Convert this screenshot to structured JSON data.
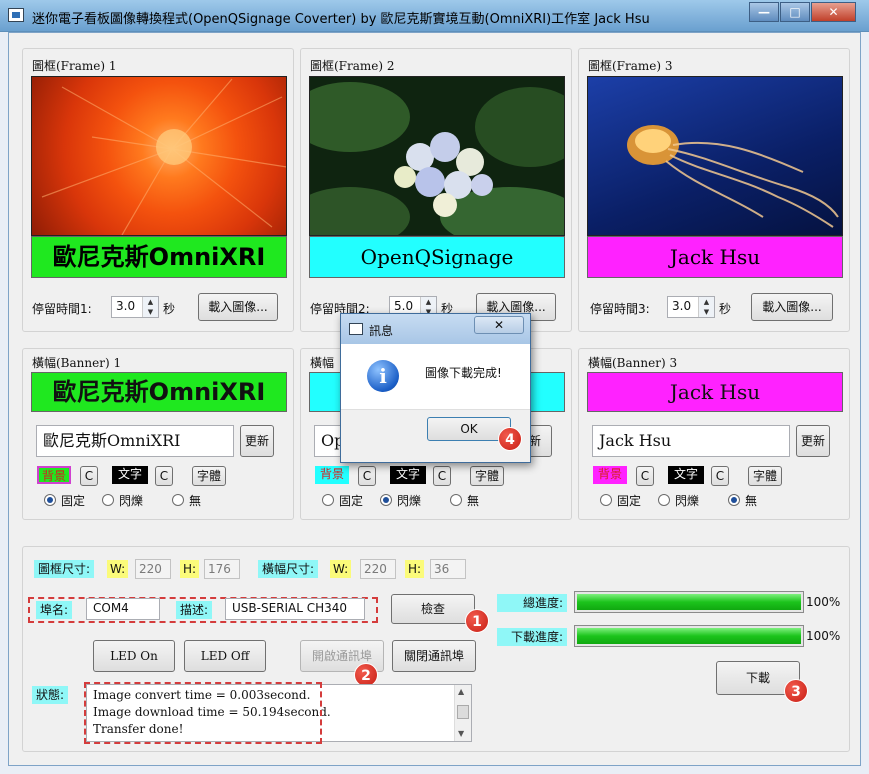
{
  "window": {
    "title": "迷你電子看板圖像轉換程式(OpenQSignage Coverter) by 歐尼克斯實境互動(OmniXRI)工作室 Jack Hsu",
    "minimize": "—",
    "maximize": "□",
    "close": "✕"
  },
  "frames": [
    {
      "label": "圖框(Frame) 1",
      "caption": "歐尼克斯OmniXRI",
      "caption_bg": "#1fe81f",
      "stay_label": "停留時間1:",
      "stay_value": "3.0",
      "unit": "秒",
      "load_button": "載入圖像..."
    },
    {
      "label": "圖框(Frame) 2",
      "caption": "OpenQSignage",
      "caption_bg": "#22ffff",
      "stay_label": "停留時間2:",
      "stay_value": "5.0",
      "unit": "秒",
      "load_button": "載入圖像..."
    },
    {
      "label": "圖框(Frame) 3",
      "caption": "Jack Hsu",
      "caption_bg": "#ff22ff",
      "stay_label": "停留時間3:",
      "stay_value": "3.0",
      "unit": "秒",
      "load_button": "載入圖像..."
    }
  ],
  "banners": [
    {
      "label": "橫幅(Banner) 1",
      "preview": "歐尼克斯OmniXRI",
      "text": "歐尼克斯OmniXRI",
      "bg": "#1fe81f",
      "update": "更新",
      "bg_label": "背景",
      "c": "C",
      "text_label": "文字",
      "font": "字體",
      "mode_fixed": "固定",
      "mode_blink": "閃爍",
      "mode_none": "無",
      "selected": "fixed"
    },
    {
      "label": "橫幅",
      "preview": "",
      "text": "Op",
      "bg": "#22ffff",
      "update": "新",
      "bg_label": "背景",
      "c": "C",
      "text_label": "文字",
      "font": "字體",
      "mode_fixed": "固定",
      "mode_blink": "閃爍",
      "mode_none": "無",
      "selected": "blink"
    },
    {
      "label": "橫幅(Banner) 3",
      "preview": "Jack Hsu",
      "text": "Jack Hsu",
      "bg": "#ff22ff",
      "update": "更新",
      "bg_label": "背景",
      "c": "C",
      "text_label": "文字",
      "font": "字體",
      "mode_fixed": "固定",
      "mode_blink": "閃爍",
      "mode_none": "無",
      "selected": "none"
    }
  ],
  "sizes": {
    "frame_size_label": "圖框尺寸:",
    "banner_size_label": "橫幅尺寸:",
    "w_label": "W:",
    "h_label": "H:",
    "frame_w": "220",
    "frame_h": "176",
    "banner_w": "220",
    "banner_h": "36"
  },
  "port": {
    "port_label": "埠名:",
    "port_value": "COM4",
    "desc_label": "描述:",
    "desc_value": "USB-SERIAL CH340",
    "check_button": "檢查",
    "led_on": "LED On",
    "led_off": "LED Off",
    "open_port": "開啟通訊埠",
    "close_port": "關閉通訊埠"
  },
  "progress": {
    "total_label": "總進度:",
    "total_percent": 100,
    "total_text": "100%",
    "download_label": "下載進度:",
    "download_percent": 100,
    "download_text": "100%",
    "download_button": "下載"
  },
  "status": {
    "label": "狀態:",
    "lines": [
      "Image convert time = 0.003second.",
      "Image download time = 50.194second.",
      "Transfer done!"
    ]
  },
  "markers": [
    "1",
    "2",
    "3",
    "4"
  ],
  "dialog": {
    "title": "訊息",
    "message": "圖像下載完成!",
    "ok": "OK",
    "icon": "info-icon"
  }
}
